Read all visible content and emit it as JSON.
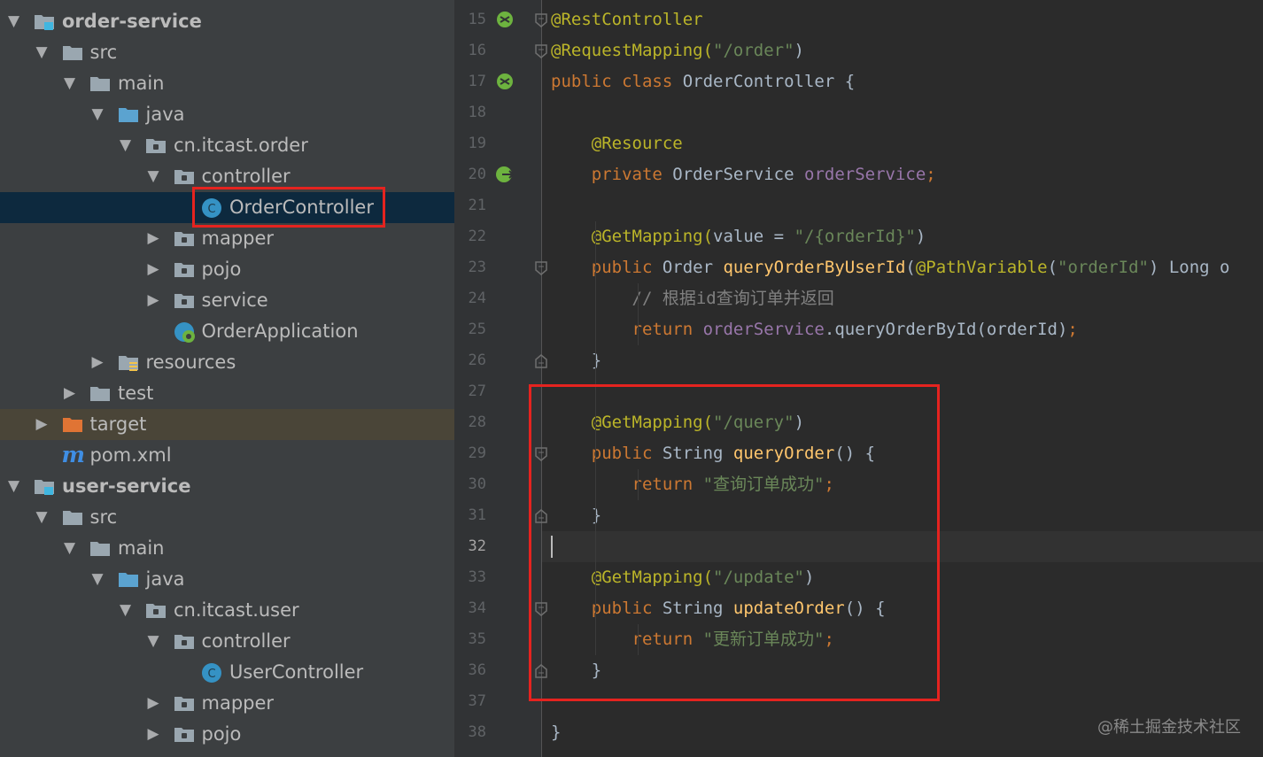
{
  "project_tree": [
    {
      "label": "order-service",
      "bold": true,
      "arrow": "▼",
      "icon": "module-folder-icon"
    },
    {
      "label": "src",
      "arrow": "▼",
      "icon": "folder-icon"
    },
    {
      "label": "main",
      "arrow": "▼",
      "icon": "folder-icon"
    },
    {
      "label": "java",
      "arrow": "▼",
      "icon": "source-folder-icon"
    },
    {
      "label": "cn.itcast.order",
      "arrow": "▼",
      "icon": "package-icon"
    },
    {
      "label": "controller",
      "arrow": "▼",
      "icon": "package-icon"
    },
    {
      "label": "OrderController",
      "arrow": "",
      "icon": "class-icon",
      "selected": true
    },
    {
      "label": "mapper",
      "arrow": "▶",
      "icon": "package-icon"
    },
    {
      "label": "pojo",
      "arrow": "▶",
      "icon": "package-icon"
    },
    {
      "label": "service",
      "arrow": "▶",
      "icon": "package-icon"
    },
    {
      "label": "OrderApplication",
      "arrow": "",
      "icon": "spring-boot-class-icon"
    },
    {
      "label": "resources",
      "arrow": "▶",
      "icon": "resources-folder-icon"
    },
    {
      "label": "test",
      "arrow": "▶",
      "icon": "folder-icon"
    },
    {
      "label": "target",
      "arrow": "▶",
      "icon": "excluded-folder-icon"
    },
    {
      "label": "pom.xml",
      "arrow": "",
      "icon": "maven-icon",
      "icon_glyph": "m"
    },
    {
      "label": "user-service",
      "bold": true,
      "arrow": "▼",
      "icon": "module-folder-icon"
    },
    {
      "label": "src",
      "arrow": "▼",
      "icon": "folder-icon"
    },
    {
      "label": "main",
      "arrow": "▼",
      "icon": "folder-icon"
    },
    {
      "label": "java",
      "arrow": "▼",
      "icon": "source-folder-icon"
    },
    {
      "label": "cn.itcast.user",
      "arrow": "▼",
      "icon": "package-icon"
    },
    {
      "label": "controller",
      "arrow": "▼",
      "icon": "package-icon"
    },
    {
      "label": "UserController",
      "arrow": "",
      "icon": "class-icon"
    },
    {
      "label": "mapper",
      "arrow": "▶",
      "icon": "package-icon"
    },
    {
      "label": "pojo",
      "arrow": "▶",
      "icon": "package-icon"
    }
  ],
  "class_icon_glyph": "C",
  "code_lines": [
    {
      "n": "15",
      "gutter_icon": "spring-bean-icon",
      "fold": "start",
      "tokens": [
        {
          "t": "@RestController",
          "c": "ann"
        }
      ]
    },
    {
      "n": "16",
      "fold": "start",
      "tokens": [
        {
          "t": "@RequestMapping(",
          "c": "ann"
        },
        {
          "t": "\"/order\"",
          "c": "str"
        },
        {
          "t": ")",
          "c": ""
        }
      ]
    },
    {
      "n": "17",
      "gutter_icon": "spring-bean-icon",
      "tokens": [
        {
          "t": "public class ",
          "c": "kw"
        },
        {
          "t": "OrderController {",
          "c": ""
        }
      ]
    },
    {
      "n": "18",
      "tokens": []
    },
    {
      "n": "19",
      "tokens": [
        {
          "t": "    ",
          "c": ""
        },
        {
          "t": "@Resource",
          "c": "ann"
        }
      ]
    },
    {
      "n": "20",
      "gutter_icon": "spring-inject-icon",
      "tokens": [
        {
          "t": "    ",
          "c": ""
        },
        {
          "t": "private ",
          "c": "kw"
        },
        {
          "t": "OrderService ",
          "c": ""
        },
        {
          "t": "orderService",
          "c": "fld"
        },
        {
          "t": ";",
          "c": "kw"
        }
      ]
    },
    {
      "n": "21",
      "tokens": []
    },
    {
      "n": "22",
      "tokens": [
        {
          "t": "    ",
          "c": ""
        },
        {
          "t": "@GetMapping(",
          "c": "ann"
        },
        {
          "t": "value = ",
          "c": ""
        },
        {
          "t": "\"/{orderId}\"",
          "c": "str"
        },
        {
          "t": ")",
          "c": ""
        }
      ]
    },
    {
      "n": "23",
      "fold": "start",
      "tokens": [
        {
          "t": "    ",
          "c": ""
        },
        {
          "t": "public ",
          "c": "kw"
        },
        {
          "t": "Order ",
          "c": ""
        },
        {
          "t": "queryOrderByUserId",
          "c": "fn"
        },
        {
          "t": "(",
          "c": ""
        },
        {
          "t": "@PathVariable",
          "c": "ann"
        },
        {
          "t": "(",
          "c": ""
        },
        {
          "t": "\"orderId\"",
          "c": "str"
        },
        {
          "t": ") Long o",
          "c": ""
        }
      ]
    },
    {
      "n": "24",
      "tokens": [
        {
          "t": "        ",
          "c": ""
        },
        {
          "t": "// 根据id查询订单并返回",
          "c": "cmt"
        }
      ]
    },
    {
      "n": "25",
      "tokens": [
        {
          "t": "        ",
          "c": ""
        },
        {
          "t": "return ",
          "c": "kw"
        },
        {
          "t": "orderService",
          "c": "fld"
        },
        {
          "t": ".queryOrderById(orderId)",
          "c": ""
        },
        {
          "t": ";",
          "c": "kw"
        }
      ]
    },
    {
      "n": "26",
      "fold": "end",
      "tokens": [
        {
          "t": "    }",
          "c": ""
        }
      ]
    },
    {
      "n": "27",
      "tokens": []
    },
    {
      "n": "28",
      "tokens": [
        {
          "t": "    ",
          "c": ""
        },
        {
          "t": "@GetMapping(",
          "c": "ann"
        },
        {
          "t": "\"/query\"",
          "c": "str"
        },
        {
          "t": ")",
          "c": ""
        }
      ]
    },
    {
      "n": "29",
      "fold": "start",
      "tokens": [
        {
          "t": "    ",
          "c": ""
        },
        {
          "t": "public ",
          "c": "kw"
        },
        {
          "t": "String ",
          "c": ""
        },
        {
          "t": "queryOrder",
          "c": "fn"
        },
        {
          "t": "() {",
          "c": ""
        }
      ]
    },
    {
      "n": "30",
      "tokens": [
        {
          "t": "        ",
          "c": ""
        },
        {
          "t": "return ",
          "c": "kw"
        },
        {
          "t": "\"查询订单成功\"",
          "c": "str"
        },
        {
          "t": ";",
          "c": "kw"
        }
      ]
    },
    {
      "n": "31",
      "fold": "end",
      "tokens": [
        {
          "t": "    }",
          "c": ""
        }
      ]
    },
    {
      "n": "32",
      "current": true,
      "tokens": []
    },
    {
      "n": "33",
      "tokens": [
        {
          "t": "    ",
          "c": ""
        },
        {
          "t": "@GetMapping(",
          "c": "ann"
        },
        {
          "t": "\"/update\"",
          "c": "str"
        },
        {
          "t": ")",
          "c": ""
        }
      ]
    },
    {
      "n": "34",
      "fold": "start",
      "tokens": [
        {
          "t": "    ",
          "c": ""
        },
        {
          "t": "public ",
          "c": "kw"
        },
        {
          "t": "String ",
          "c": ""
        },
        {
          "t": "updateOrder",
          "c": "fn"
        },
        {
          "t": "() {",
          "c": ""
        }
      ]
    },
    {
      "n": "35",
      "tokens": [
        {
          "t": "        ",
          "c": ""
        },
        {
          "t": "return ",
          "c": "kw"
        },
        {
          "t": "\"更新订单成功\"",
          "c": "str"
        },
        {
          "t": ";",
          "c": "kw"
        }
      ]
    },
    {
      "n": "36",
      "fold": "end",
      "tokens": [
        {
          "t": "    }",
          "c": ""
        }
      ]
    },
    {
      "n": "37",
      "tokens": []
    },
    {
      "n": "38",
      "tokens": [
        {
          "t": "}",
          "c": ""
        }
      ]
    }
  ],
  "watermark": "@稀土掘金技术社区",
  "colors": {
    "highlight_box": "#e5231f",
    "selection": "#0d293e",
    "keyword": "#cc7832",
    "annotation": "#bbb529",
    "string": "#6a8759",
    "method": "#ffc66d",
    "field": "#9876aa"
  }
}
